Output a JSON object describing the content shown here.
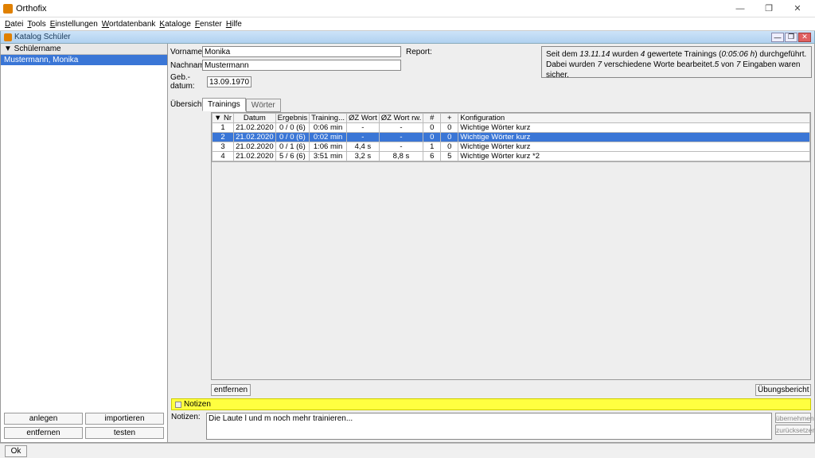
{
  "app": {
    "title": "Orthofix"
  },
  "menu": [
    "Datei",
    "Tools",
    "Einstellungen",
    "Wortdatenbank",
    "Kataloge",
    "Fenster",
    "Hilfe"
  ],
  "mdi": {
    "title": "Katalog Schüler"
  },
  "sidebar": {
    "header": "▼ Schülername",
    "selected": "Mustermann, Monika",
    "buttons": {
      "anlegen": "anlegen",
      "importieren": "importieren",
      "entfernen": "entfernen",
      "testen": "testen"
    }
  },
  "form": {
    "vorname_lbl": "Vorname:",
    "vorname": "Monika",
    "nachname_lbl": "Nachname:",
    "nachname": "Mustermann",
    "geb_lbl": "Geb.-datum:",
    "geb": "13.09.1970",
    "report_lbl": "Report:"
  },
  "report": {
    "line1_a": "Seit dem ",
    "date": "13.11.14",
    "line1_b": " wurden ",
    "count": "4",
    "line1_c": " gewertete Trainings (",
    "dur": "0:05:06 h",
    "line1_d": ") durchgeführt.",
    "line2_a": "Dabei wurden ",
    "w": "7",
    "line2_b": " verschiedene Worte bearbeitet.",
    "s1": "5",
    "line2_c": " von ",
    "s2": "7",
    "line2_d": " Eingaben waren sicher."
  },
  "overview": {
    "label": "Übersicht:",
    "tabs": {
      "active": "Trainings",
      "inactive": "Wörter"
    },
    "headers": {
      "nr": "▼ Nr",
      "datum": "Datum",
      "ergebnis": "Ergebnis",
      "trainmin": "Training...",
      "ozwort": "ØZ Wort",
      "ozwortrw": "ØZ Wort rw.",
      "hash": "#",
      "plus": "+",
      "konfig": "Konfiguration"
    },
    "rows": [
      {
        "nr": "1",
        "datum": "21.02.2020",
        "erg": "0 / 0 (6)",
        "tr": "0:06 min",
        "oz": "-",
        "ozrw": "-",
        "h": "0",
        "p": "0",
        "k": "Wichtige Wörter kurz"
      },
      {
        "nr": "2",
        "datum": "21.02.2020",
        "erg": "0 / 0 (6)",
        "tr": "0:02 min",
        "oz": "-",
        "ozrw": "-",
        "h": "0",
        "p": "0",
        "k": "Wichtige Wörter kurz",
        "sel": true
      },
      {
        "nr": "3",
        "datum": "21.02.2020",
        "erg": "0 / 1 (6)",
        "tr": "1:06 min",
        "oz": "4,4 s",
        "ozrw": "-",
        "h": "1",
        "p": "0",
        "k": "Wichtige Wörter kurz"
      },
      {
        "nr": "4",
        "datum": "21.02.2020",
        "erg": "5 / 6 (6)",
        "tr": "3:51 min",
        "oz": "3,2 s",
        "ozrw": "8,8 s",
        "h": "6",
        "p": "5",
        "k": "Wichtige Wörter kurz *2"
      }
    ],
    "entfernen": "entfernen",
    "bericht": "Übungsbericht"
  },
  "notes": {
    "bar": "Notizen",
    "label": "Notizen:",
    "text": "Die Laute l und m noch mehr trainieren...",
    "uebernehmen": "übernehmen",
    "zuruecksetzen": "zurücksetzen"
  },
  "bottom": {
    "ok": "Ok"
  }
}
